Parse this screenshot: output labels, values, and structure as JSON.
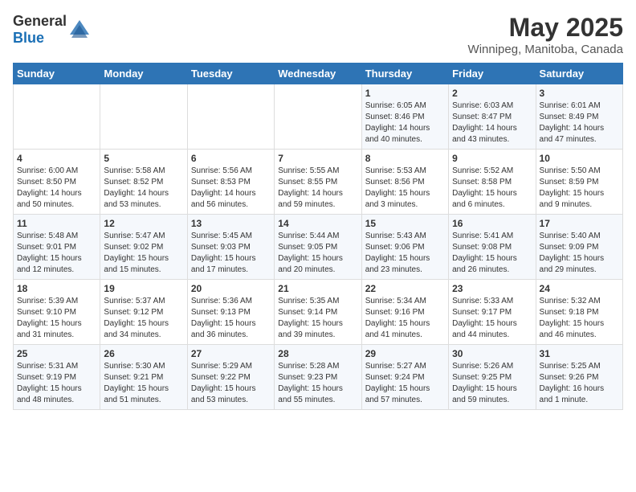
{
  "logo": {
    "text_general": "General",
    "text_blue": "Blue"
  },
  "title": "May 2025",
  "subtitle": "Winnipeg, Manitoba, Canada",
  "days_of_week": [
    "Sunday",
    "Monday",
    "Tuesday",
    "Wednesday",
    "Thursday",
    "Friday",
    "Saturday"
  ],
  "weeks": [
    [
      {
        "day": "",
        "info": ""
      },
      {
        "day": "",
        "info": ""
      },
      {
        "day": "",
        "info": ""
      },
      {
        "day": "",
        "info": ""
      },
      {
        "day": "1",
        "info": "Sunrise: 6:05 AM\nSunset: 8:46 PM\nDaylight: 14 hours\nand 40 minutes."
      },
      {
        "day": "2",
        "info": "Sunrise: 6:03 AM\nSunset: 8:47 PM\nDaylight: 14 hours\nand 43 minutes."
      },
      {
        "day": "3",
        "info": "Sunrise: 6:01 AM\nSunset: 8:49 PM\nDaylight: 14 hours\nand 47 minutes."
      }
    ],
    [
      {
        "day": "4",
        "info": "Sunrise: 6:00 AM\nSunset: 8:50 PM\nDaylight: 14 hours\nand 50 minutes."
      },
      {
        "day": "5",
        "info": "Sunrise: 5:58 AM\nSunset: 8:52 PM\nDaylight: 14 hours\nand 53 minutes."
      },
      {
        "day": "6",
        "info": "Sunrise: 5:56 AM\nSunset: 8:53 PM\nDaylight: 14 hours\nand 56 minutes."
      },
      {
        "day": "7",
        "info": "Sunrise: 5:55 AM\nSunset: 8:55 PM\nDaylight: 14 hours\nand 59 minutes."
      },
      {
        "day": "8",
        "info": "Sunrise: 5:53 AM\nSunset: 8:56 PM\nDaylight: 15 hours\nand 3 minutes."
      },
      {
        "day": "9",
        "info": "Sunrise: 5:52 AM\nSunset: 8:58 PM\nDaylight: 15 hours\nand 6 minutes."
      },
      {
        "day": "10",
        "info": "Sunrise: 5:50 AM\nSunset: 8:59 PM\nDaylight: 15 hours\nand 9 minutes."
      }
    ],
    [
      {
        "day": "11",
        "info": "Sunrise: 5:48 AM\nSunset: 9:01 PM\nDaylight: 15 hours\nand 12 minutes."
      },
      {
        "day": "12",
        "info": "Sunrise: 5:47 AM\nSunset: 9:02 PM\nDaylight: 15 hours\nand 15 minutes."
      },
      {
        "day": "13",
        "info": "Sunrise: 5:45 AM\nSunset: 9:03 PM\nDaylight: 15 hours\nand 17 minutes."
      },
      {
        "day": "14",
        "info": "Sunrise: 5:44 AM\nSunset: 9:05 PM\nDaylight: 15 hours\nand 20 minutes."
      },
      {
        "day": "15",
        "info": "Sunrise: 5:43 AM\nSunset: 9:06 PM\nDaylight: 15 hours\nand 23 minutes."
      },
      {
        "day": "16",
        "info": "Sunrise: 5:41 AM\nSunset: 9:08 PM\nDaylight: 15 hours\nand 26 minutes."
      },
      {
        "day": "17",
        "info": "Sunrise: 5:40 AM\nSunset: 9:09 PM\nDaylight: 15 hours\nand 29 minutes."
      }
    ],
    [
      {
        "day": "18",
        "info": "Sunrise: 5:39 AM\nSunset: 9:10 PM\nDaylight: 15 hours\nand 31 minutes."
      },
      {
        "day": "19",
        "info": "Sunrise: 5:37 AM\nSunset: 9:12 PM\nDaylight: 15 hours\nand 34 minutes."
      },
      {
        "day": "20",
        "info": "Sunrise: 5:36 AM\nSunset: 9:13 PM\nDaylight: 15 hours\nand 36 minutes."
      },
      {
        "day": "21",
        "info": "Sunrise: 5:35 AM\nSunset: 9:14 PM\nDaylight: 15 hours\nand 39 minutes."
      },
      {
        "day": "22",
        "info": "Sunrise: 5:34 AM\nSunset: 9:16 PM\nDaylight: 15 hours\nand 41 minutes."
      },
      {
        "day": "23",
        "info": "Sunrise: 5:33 AM\nSunset: 9:17 PM\nDaylight: 15 hours\nand 44 minutes."
      },
      {
        "day": "24",
        "info": "Sunrise: 5:32 AM\nSunset: 9:18 PM\nDaylight: 15 hours\nand 46 minutes."
      }
    ],
    [
      {
        "day": "25",
        "info": "Sunrise: 5:31 AM\nSunset: 9:19 PM\nDaylight: 15 hours\nand 48 minutes."
      },
      {
        "day": "26",
        "info": "Sunrise: 5:30 AM\nSunset: 9:21 PM\nDaylight: 15 hours\nand 51 minutes."
      },
      {
        "day": "27",
        "info": "Sunrise: 5:29 AM\nSunset: 9:22 PM\nDaylight: 15 hours\nand 53 minutes."
      },
      {
        "day": "28",
        "info": "Sunrise: 5:28 AM\nSunset: 9:23 PM\nDaylight: 15 hours\nand 55 minutes."
      },
      {
        "day": "29",
        "info": "Sunrise: 5:27 AM\nSunset: 9:24 PM\nDaylight: 15 hours\nand 57 minutes."
      },
      {
        "day": "30",
        "info": "Sunrise: 5:26 AM\nSunset: 9:25 PM\nDaylight: 15 hours\nand 59 minutes."
      },
      {
        "day": "31",
        "info": "Sunrise: 5:25 AM\nSunset: 9:26 PM\nDaylight: 16 hours\nand 1 minute."
      }
    ]
  ]
}
